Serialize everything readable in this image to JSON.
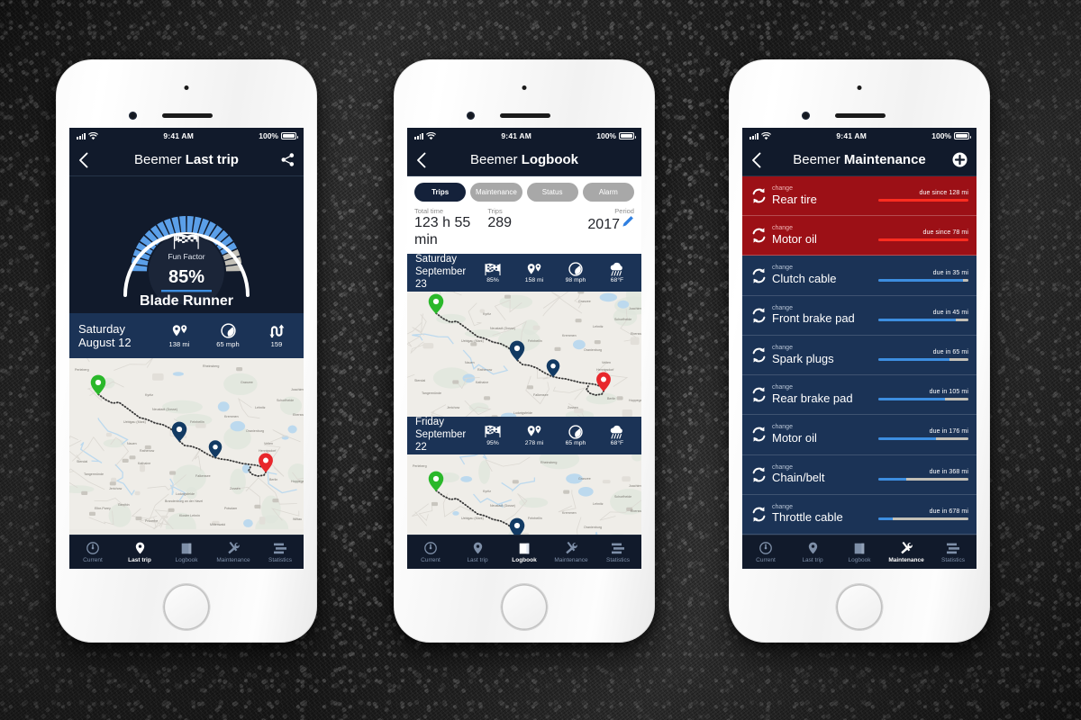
{
  "phones": [
    {
      "id": "phone-1",
      "statusbar": {
        "time": "9:41 AM",
        "battery": "100%",
        "signal_icon": "signal-bars-icon",
        "wifi_icon": "wifi-icon",
        "battery_icon": "battery-full-icon"
      },
      "nav": {
        "back_icon": "back-chevron-icon",
        "title_light": "Beemer",
        "title_bold": "Last trip",
        "action_icon": "share-icon"
      },
      "gauge": {
        "flag_icon": "checkered-flags-icon",
        "caption": "Fun Factor",
        "value": "85%",
        "percent": 85,
        "name": "Blade Runner"
      },
      "trip": {
        "day": "Saturday",
        "date": "August 12",
        "stats": [
          {
            "icon": "map-pins-icon",
            "value": "138 mi"
          },
          {
            "icon": "speedometer-icon",
            "value": "65 mph"
          },
          {
            "icon": "curves-icon",
            "value": "159"
          }
        ]
      },
      "tabs": [
        {
          "label": "Current",
          "icon": "gauge-icon",
          "active": false
        },
        {
          "label": "Last trip",
          "icon": "pin-icon",
          "active": true
        },
        {
          "label": "Logbook",
          "icon": "book-icon",
          "active": false
        },
        {
          "label": "Maintenance",
          "icon": "tools-icon",
          "active": false
        },
        {
          "label": "Statistics",
          "icon": "bars-icon",
          "active": false
        }
      ]
    },
    {
      "id": "phone-2",
      "statusbar": {
        "time": "9:41 AM",
        "battery": "100%"
      },
      "nav": {
        "title_light": "Beemer",
        "title_bold": "Logbook"
      },
      "filters": [
        {
          "label": "Trips",
          "active": true
        },
        {
          "label": "Maintenance",
          "active": false
        },
        {
          "label": "Status",
          "active": false
        },
        {
          "label": "Alarm",
          "active": false
        }
      ],
      "summary": [
        {
          "key": "Total time",
          "value": "123 h 55 min"
        },
        {
          "key": "Trips",
          "value": "289"
        },
        {
          "key": "Period",
          "value": "2017",
          "edit_icon": "pencil-icon"
        }
      ],
      "entries": [
        {
          "day": "Saturday",
          "date": "September 23",
          "stats": [
            {
              "icon": "checkered-flags-icon",
              "value": "85%"
            },
            {
              "icon": "map-pins-icon",
              "value": "158 mi"
            },
            {
              "icon": "speedometer-icon",
              "value": "98 mph"
            },
            {
              "icon": "rain-cloud-icon",
              "value": "68°F"
            }
          ]
        },
        {
          "day": "Friday",
          "date": "September 22",
          "stats": [
            {
              "icon": "checkered-flags-icon",
              "value": "95%"
            },
            {
              "icon": "map-pins-icon",
              "value": "278 mi"
            },
            {
              "icon": "speedometer-icon",
              "value": "65 mph"
            },
            {
              "icon": "rain-cloud-icon",
              "value": "68°F"
            }
          ]
        }
      ],
      "tabs": [
        {
          "label": "Current",
          "icon": "gauge-icon",
          "active": false
        },
        {
          "label": "Last trip",
          "icon": "pin-icon",
          "active": false
        },
        {
          "label": "Logbook",
          "icon": "book-icon",
          "active": true
        },
        {
          "label": "Maintenance",
          "icon": "tools-icon",
          "active": false
        },
        {
          "label": "Statistics",
          "icon": "bars-icon",
          "active": false
        }
      ]
    },
    {
      "id": "phone-3",
      "statusbar": {
        "time": "9:41 AM",
        "battery": "100%"
      },
      "nav": {
        "title_light": "Beemer",
        "title_bold": "Maintenance",
        "action_icon": "add-plus-icon"
      },
      "items": [
        {
          "action": "change",
          "name": "Rear tire",
          "due": "due since 128 mi",
          "urgent": true,
          "progress": 100
        },
        {
          "action": "change",
          "name": "Motor oil",
          "due": "due since 78 mi",
          "urgent": true,
          "progress": 100
        },
        {
          "action": "change",
          "name": "Clutch cable",
          "due": "due in 35 mi",
          "urgent": false,
          "progress": 94
        },
        {
          "action": "change",
          "name": "Front brake pad",
          "due": "due in 45 mi",
          "urgent": false,
          "progress": 86
        },
        {
          "action": "change",
          "name": "Spark plugs",
          "due": "due in 65 mi",
          "urgent": false,
          "progress": 79
        },
        {
          "action": "change",
          "name": "Rear brake pad",
          "due": "due in 105 mi",
          "urgent": false,
          "progress": 74
        },
        {
          "action": "change",
          "name": "Motor oil",
          "due": "due in 176 mi",
          "urgent": false,
          "progress": 64
        },
        {
          "action": "change",
          "name": "Chain/belt",
          "due": "due in 368 mi",
          "urgent": false,
          "progress": 31
        },
        {
          "action": "change",
          "name": "Throttle cable",
          "due": "due in 678 mi",
          "urgent": false,
          "progress": 16
        }
      ],
      "tabs": [
        {
          "label": "Current",
          "icon": "gauge-icon",
          "active": false
        },
        {
          "label": "Last trip",
          "icon": "pin-icon",
          "active": false
        },
        {
          "label": "Logbook",
          "icon": "book-icon",
          "active": false
        },
        {
          "label": "Maintenance",
          "icon": "tools-icon",
          "active": true
        },
        {
          "label": "Statistics",
          "icon": "bars-icon",
          "active": false
        }
      ]
    }
  ],
  "map": {
    "start_pin": "green-start-pin-icon",
    "end_pin": "red-destination-pin-icon",
    "waypoint_pin": "blue-waypoint-pin-icon",
    "labels": [
      "Perleberg",
      "Rheinsberg",
      "Kyritz",
      "Granzee",
      "Joachimsthal",
      "Neustadt (Dosse)",
      "Fehrbellin",
      "Oranienburg",
      "Schorfheide",
      "Lehnitz",
      "Eberswalde",
      "Stendal",
      "Kathaine",
      "Kremmen",
      "Berlin",
      "Hoppegarten",
      "Tangermünde",
      "Pritzerbe",
      "Brandenburg an der Havel",
      "Potsdam",
      "Elbe-Parey",
      "Genthin",
      "Kloster Lehnin",
      "Mittenwald",
      "Wittau",
      "Nauen",
      "Rathenow",
      "Hennigsdorf",
      "Velten",
      "Falkensee",
      "Uebigau (Mark)",
      "Ludwigsfelde",
      "Zossen",
      "Jerichow"
    ],
    "route_color": "#3a3a3a"
  },
  "colors": {
    "navy_dark": "#111a2b",
    "navy_row": "#1b3356",
    "accent_blue": "#3d8ee0",
    "danger_red": "#9c1016",
    "danger_bar": "#ff2d20",
    "gauge_blue": "#5b9fe8",
    "gauge_gray": "#c3c0b7"
  }
}
